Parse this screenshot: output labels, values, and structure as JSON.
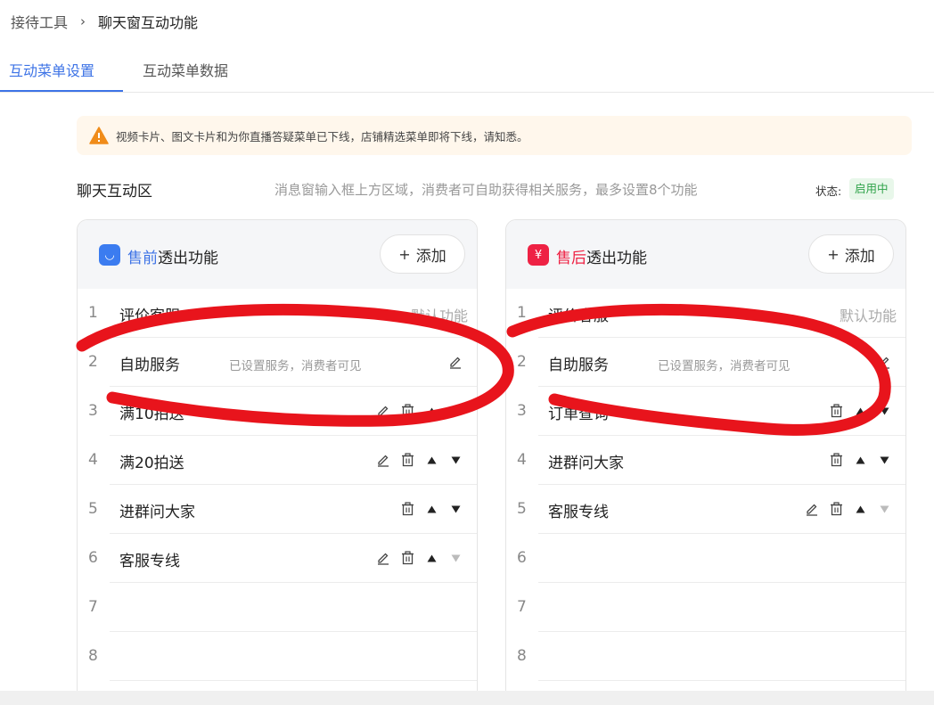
{
  "breadcrumb": {
    "parent": "接待工具",
    "current": "聊天窗互动功能"
  },
  "tabs": [
    {
      "label": "互动菜单设置",
      "active": true
    },
    {
      "label": "互动菜单数据",
      "active": false
    }
  ],
  "notice": {
    "text": "视频卡片、图文卡片和为你直播答疑菜单已下线，店铺精选菜单即将下线，请知悉。"
  },
  "section": {
    "title": "聊天互动区",
    "description": "消息窗输入框上方区域，消费者可自助获得相关服务，最多设置8个功能",
    "status_label": "状态:",
    "status_value": "启用中"
  },
  "panels": [
    {
      "title_highlight": "售前",
      "title_rest": "透出功能",
      "icon": "bag-icon",
      "icon_glyph": "◡",
      "add_label": "添加",
      "rows": [
        {
          "num": "1",
          "name": "评价客服",
          "default": "默认功能"
        },
        {
          "num": "2",
          "name": "自助服务",
          "hint": "已设置服务，消费者可见"
        },
        {
          "num": "3",
          "name": "满10拍送"
        },
        {
          "num": "4",
          "name": "满20拍送"
        },
        {
          "num": "5",
          "name": "进群问大家"
        },
        {
          "num": "6",
          "name": "客服专线"
        },
        {
          "num": "7",
          "name": ""
        },
        {
          "num": "8",
          "name": ""
        }
      ]
    },
    {
      "title_highlight": "售后",
      "title_rest": "透出功能",
      "icon": "yen-icon",
      "icon_glyph": "¥",
      "add_label": "添加",
      "rows": [
        {
          "num": "1",
          "name": "评价客服",
          "default": "默认功能"
        },
        {
          "num": "2",
          "name": "自助服务",
          "hint": "已设置服务，消费者可见"
        },
        {
          "num": "3",
          "name": "订单查询"
        },
        {
          "num": "4",
          "name": "进群问大家"
        },
        {
          "num": "5",
          "name": "客服专线"
        },
        {
          "num": "6",
          "name": ""
        },
        {
          "num": "7",
          "name": ""
        },
        {
          "num": "8",
          "name": ""
        }
      ]
    }
  ],
  "colors": {
    "accent": "#3d73e6",
    "after_sale": "#ee2244",
    "status_green": "#2fa34a",
    "scribble": "#e8141c"
  }
}
